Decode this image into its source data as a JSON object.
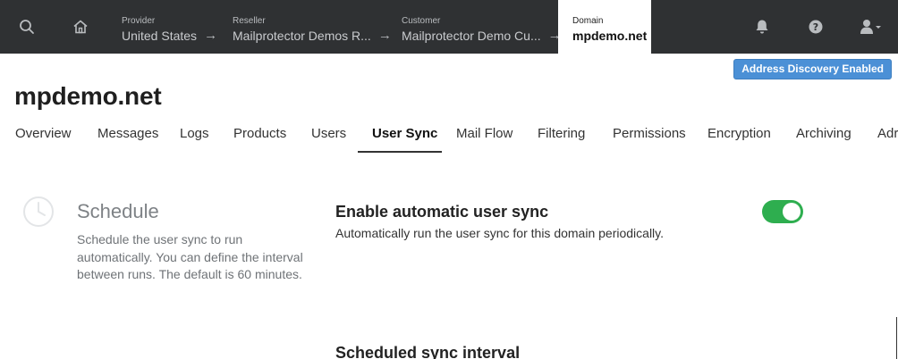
{
  "topbar": {
    "breadcrumbs": [
      {
        "label": "Provider",
        "value": "United States"
      },
      {
        "label": "Reseller",
        "value": "Mailprotector Demos R..."
      },
      {
        "label": "Customer",
        "value": "Mailprotector Demo Cu..."
      },
      {
        "label": "Domain",
        "value": "mpdemo.net"
      }
    ],
    "arrow": "→",
    "icons": {
      "search": "search-icon",
      "home": "home-icon",
      "notifications": "bell-icon",
      "help": "help-icon",
      "user": "user-icon"
    }
  },
  "address_discovery_label": "Address Discovery Enabled",
  "page_title": "mpdemo.net",
  "tabs": [
    {
      "label": "Overview"
    },
    {
      "label": "Messages"
    },
    {
      "label": "Logs"
    },
    {
      "label": "Products"
    },
    {
      "label": "Users"
    },
    {
      "label": "User Sync"
    },
    {
      "label": "Mail Flow"
    },
    {
      "label": "Filtering"
    },
    {
      "label": "Permissions"
    },
    {
      "label": "Encryption"
    },
    {
      "label": "Archiving"
    },
    {
      "label": "Adr"
    }
  ],
  "active_tab": "User Sync",
  "schedule": {
    "heading": "Schedule",
    "description": "Schedule the user sync to run automatically. You can define the interval between runs. The default is 60 minutes."
  },
  "auto_sync": {
    "title": "Enable automatic user sync",
    "description": "Automatically run the user sync for this domain periodically.",
    "enabled": true
  },
  "interval": {
    "title": "Scheduled sync interval"
  },
  "colors": {
    "topbar": "#2f3133",
    "accent": "#4b90d6",
    "toggle_on": "#2eae4f"
  }
}
